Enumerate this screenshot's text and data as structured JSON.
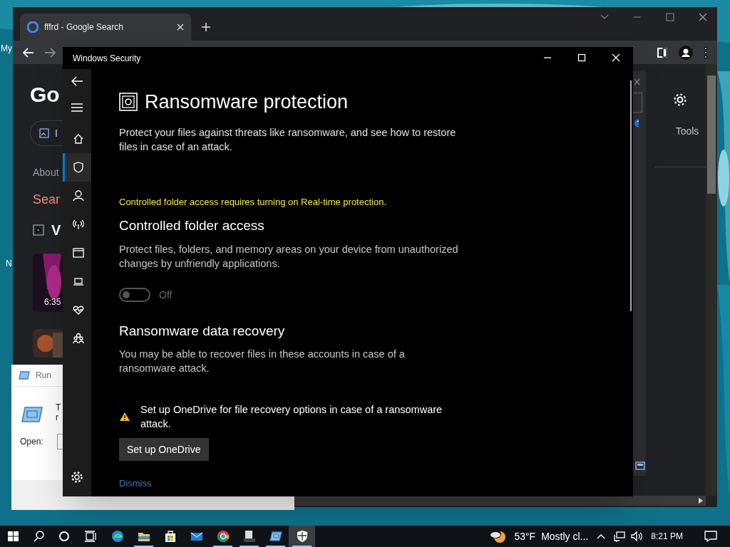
{
  "desktop": {
    "icon_labels": [
      "My",
      "N"
    ]
  },
  "browser": {
    "tab": {
      "title": "fffrd - Google Search"
    },
    "page": {
      "logo": "Go",
      "chip": "I",
      "about": "About",
      "search_heading": "Sear",
      "video_heading": "V",
      "video_duration": "6:35",
      "tools": "Tools"
    }
  },
  "run_dialog": {
    "title": "Run",
    "prompt_lines": [
      "T",
      "r"
    ],
    "open_label": "Open:"
  },
  "security": {
    "window_title": "Windows Security",
    "sidebar": [
      {
        "kind": "home",
        "selected": false
      },
      {
        "kind": "shield",
        "selected": true
      },
      {
        "kind": "person",
        "selected": false
      },
      {
        "kind": "antenna",
        "selected": false
      },
      {
        "kind": "window",
        "selected": false
      },
      {
        "kind": "laptop",
        "selected": false
      },
      {
        "kind": "heart",
        "selected": false
      },
      {
        "kind": "family",
        "selected": false
      }
    ],
    "heading": "Ransomware protection",
    "intro": "Protect your files against threats like ransomware, and see how to restore files in case of an attack.",
    "notice": "Controlled folder access requires turning on Real-time protection.",
    "cfa": {
      "title": "Controlled folder access",
      "description": "Protect files, folders, and memory areas on your device from unauthorized changes by unfriendly applications.",
      "toggle": {
        "on": false,
        "label": "Off"
      }
    },
    "recovery": {
      "title": "Ransomware data recovery",
      "description": "You may be able to recover files in these accounts in case of a ransomware attack.",
      "warning": "Set up OneDrive for file recovery options in case of a ransomware attack.",
      "button": "Set up OneDrive",
      "link": "Dismiss"
    }
  },
  "taskbar": {
    "apps": [
      {
        "kind": "edge",
        "running": false,
        "selected": false
      },
      {
        "kind": "folder",
        "running": true,
        "selected": false
      },
      {
        "kind": "store",
        "running": false,
        "selected": false
      },
      {
        "kind": "mail",
        "running": false,
        "selected": false
      },
      {
        "kind": "chrome",
        "running": true,
        "selected": false
      },
      {
        "kind": "terminal",
        "running": true,
        "selected": false
      },
      {
        "kind": "run",
        "running": true,
        "selected": false
      },
      {
        "kind": "shield",
        "running": true,
        "selected": true
      }
    ],
    "weather": {
      "temp": "53°F",
      "condition": "Mostly cl..."
    },
    "time": "8:21 PM"
  }
}
